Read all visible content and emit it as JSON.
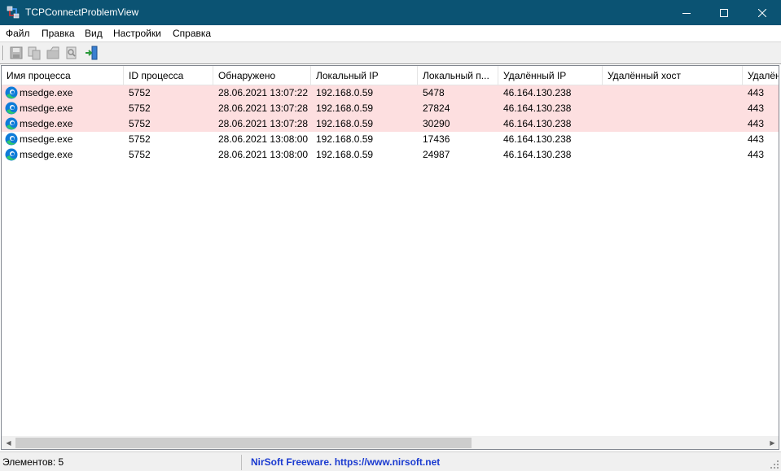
{
  "window": {
    "title": "TCPConnectProblemView"
  },
  "menu": [
    "Файл",
    "Правка",
    "Вид",
    "Настройки",
    "Справка"
  ],
  "toolbar": {
    "buttons": [
      "save-icon",
      "copy-icon",
      "properties-icon",
      "find-icon",
      "exit-icon"
    ]
  },
  "columns": [
    "Имя процесса",
    "ID процесса",
    "Обнаружено",
    "Локальный IP",
    "Локальный п...",
    "Удалённый IP",
    "Удалённый хост",
    "Удалён"
  ],
  "rows": [
    {
      "highlight": true,
      "process": "msedge.exe",
      "pid": "5752",
      "detected": "28.06.2021 13:07:22",
      "local_ip": "192.168.0.59",
      "local_port": "5478",
      "remote_ip": "46.164.130.238",
      "remote_host": "",
      "remote_port": "443"
    },
    {
      "highlight": true,
      "process": "msedge.exe",
      "pid": "5752",
      "detected": "28.06.2021 13:07:28",
      "local_ip": "192.168.0.59",
      "local_port": "27824",
      "remote_ip": "46.164.130.238",
      "remote_host": "",
      "remote_port": "443"
    },
    {
      "highlight": true,
      "process": "msedge.exe",
      "pid": "5752",
      "detected": "28.06.2021 13:07:28",
      "local_ip": "192.168.0.59",
      "local_port": "30290",
      "remote_ip": "46.164.130.238",
      "remote_host": "",
      "remote_port": "443"
    },
    {
      "highlight": false,
      "process": "msedge.exe",
      "pid": "5752",
      "detected": "28.06.2021 13:08:00",
      "local_ip": "192.168.0.59",
      "local_port": "17436",
      "remote_ip": "46.164.130.238",
      "remote_host": "",
      "remote_port": "443"
    },
    {
      "highlight": false,
      "process": "msedge.exe",
      "pid": "5752",
      "detected": "28.06.2021 13:08:00",
      "local_ip": "192.168.0.59",
      "local_port": "24987",
      "remote_ip": "46.164.130.238",
      "remote_host": "",
      "remote_port": "443"
    }
  ],
  "status": {
    "count": "Элементов: 5",
    "link": "NirSoft Freeware. https://www.nirsoft.net"
  },
  "colors": {
    "titlebar": "#0b5373",
    "highlight_row": "#fddfe0",
    "link": "#1a3ad0"
  }
}
